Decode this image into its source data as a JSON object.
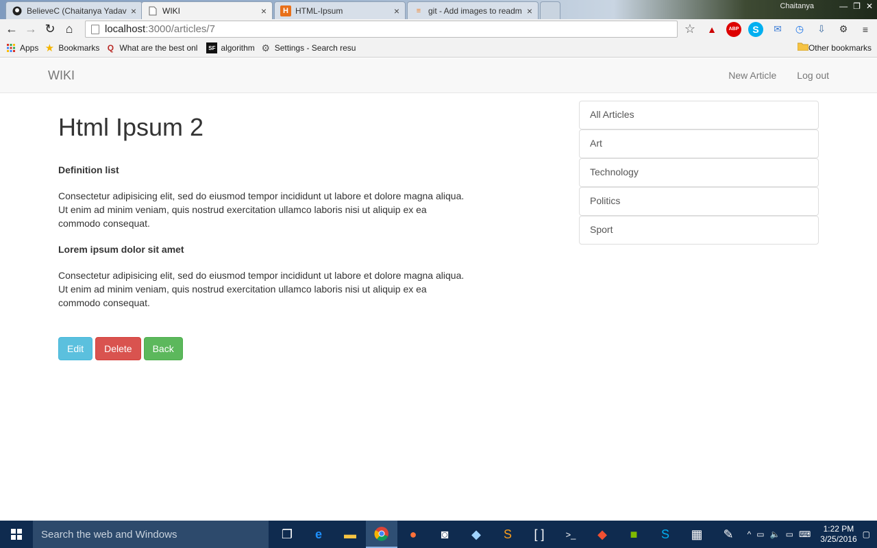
{
  "browser": {
    "tabs": [
      {
        "title": "BelieveC (Chaitanya Yadav",
        "icon": "github-icon"
      },
      {
        "title": "WIKI",
        "icon": "page-icon"
      },
      {
        "title": "HTML-Ipsum",
        "icon": "html-ipsum-icon"
      },
      {
        "title": "git - Add images to readm",
        "icon": "stackoverflow-icon"
      }
    ],
    "user_label": "Chaitanya",
    "address": {
      "host": "localhost",
      "path": ":3000/articles/7"
    },
    "bookmarks": [
      {
        "label": "Apps",
        "icon": "apps-grid-icon"
      },
      {
        "label": "Bookmarks",
        "icon": "star-icon"
      },
      {
        "label": "What are the best onl",
        "icon": "quora-icon"
      },
      {
        "label": "algorithm",
        "icon": "sf-icon"
      },
      {
        "label": "Settings - Search resu",
        "icon": "gear-icon"
      }
    ],
    "other_bookmarks": "Other bookmarks"
  },
  "navbar": {
    "brand": "WIKI",
    "links": [
      "New Article",
      "Log out"
    ]
  },
  "article": {
    "title": "Html Ipsum 2",
    "sections": [
      {
        "heading": "Definition list",
        "body": "Consectetur adipisicing elit, sed do eiusmod tempor incididunt ut labore et dolore magna aliqua. Ut enim ad minim veniam, quis nostrud exercitation ullamco laboris nisi ut aliquip ex ea commodo consequat."
      },
      {
        "heading": "Lorem ipsum dolor sit amet",
        "body": "Consectetur adipisicing elit, sed do eiusmod tempor incididunt ut labore et dolore magna aliqua. Ut enim ad minim veniam, quis nostrud exercitation ullamco laboris nisi ut aliquip ex ea commodo consequat."
      }
    ],
    "buttons": {
      "edit": "Edit",
      "delete": "Delete",
      "back": "Back"
    }
  },
  "sidebar": {
    "categories": [
      "All Articles",
      "Art",
      "Technology",
      "Politics",
      "Sport"
    ]
  },
  "taskbar": {
    "search_placeholder": "Search the web and Windows",
    "time": "1:22 PM",
    "date": "3/25/2016"
  },
  "colors": {
    "info": "#5bc0de",
    "danger": "#d9534f",
    "success": "#5cb85c",
    "taskbar": "#0f2b4f"
  }
}
